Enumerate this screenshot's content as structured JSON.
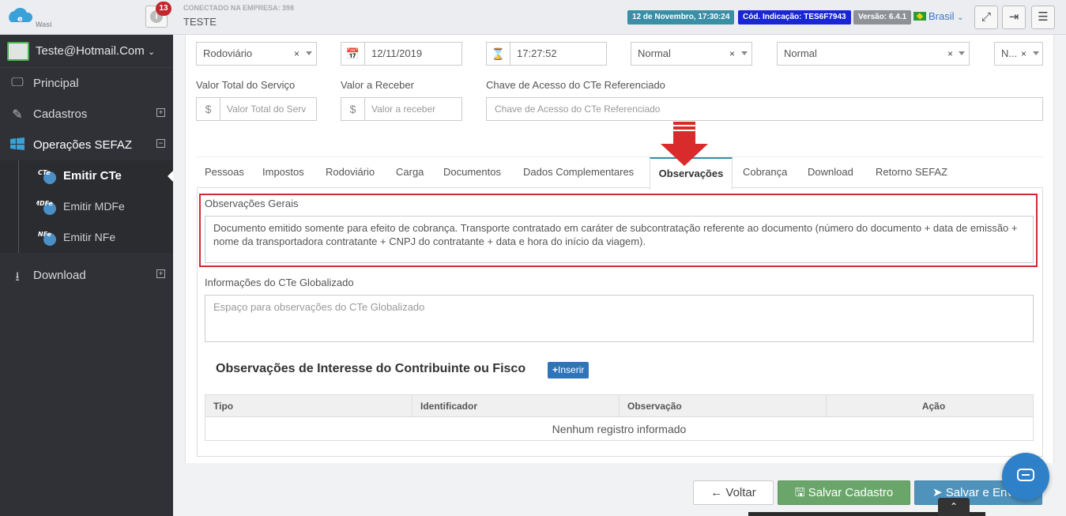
{
  "header": {
    "logo_text": "Wasi",
    "notification_count": "13",
    "company_label": "CONECTADO NA EMPRESA: 398",
    "company_name": "TESTE",
    "date_tag": "12 de Novembro, 17:30:24",
    "code_tag": "Cód. Indicação: TES6F7943",
    "version_tag": "Versão: 6.4.1",
    "language": "Brasil",
    "icons": [
      "expand-icon",
      "logout-icon",
      "menu-icon"
    ],
    "colors": {
      "date": "#3a8ea5",
      "code": "#1826d6",
      "version": "#8e9296",
      "badge": "#c1272d"
    }
  },
  "sidebar": {
    "user": "Teste@Hotmail.Com",
    "items": [
      {
        "label": "Principal",
        "icon": "monitor-icon"
      },
      {
        "label": "Cadastros",
        "icon": "edit-icon"
      },
      {
        "label": "Operações SEFAZ",
        "icon": "windows-icon"
      },
      {
        "label": "Download",
        "icon": "download-icon"
      }
    ],
    "subitems": [
      {
        "label": "Emitir CTe",
        "icon_text": "CTe"
      },
      {
        "label": "Emitir MDFe",
        "icon_text": "MDFe"
      },
      {
        "label": "Emitir NFe",
        "icon_text": "NFe"
      }
    ]
  },
  "form": {
    "modal": "Rodoviário",
    "date": "12/11/2019",
    "time": "17:27:52",
    "select1": "Normal",
    "select2": "Normal",
    "select3": "N...",
    "valor_total_label": "Valor Total do Serviço",
    "valor_total_placeholder": "Valor Total do Serv",
    "valor_receber_label": "Valor a Receber",
    "valor_receber_placeholder": "Valor a receber",
    "chave_label": "Chave de Acesso do CTe Referenciado",
    "chave_placeholder": "Chave de Acesso do CTe Referenciado",
    "currency_symbol": "$"
  },
  "tabs": [
    "Pessoas",
    "Impostos",
    "Rodoviário",
    "Carga",
    "Documentos",
    "Dados Complementares",
    "Observações",
    "Cobrança",
    "Download",
    "Retorno SEFAZ"
  ],
  "obs": {
    "gerais_label": "Observações Gerais",
    "gerais_text": "Documento emitido somente para efeito de cobrança. Transporte contratado em caráter de subcontratação referente ao documento (número do documento + data de emissão + nome da transportadora contratante + CNPJ do contratante + data e hora do início da viagem).",
    "glob_label": "Informações do CTe Globalizado",
    "glob_placeholder": "Espaço para observações do CTe Globalizado",
    "section_title": "Observações de Interesse do Contribuinte ou Fisco",
    "insert_button": "Inserir",
    "columns": [
      "Tipo",
      "Identificador",
      "Observação",
      "Ação"
    ],
    "empty": "Nenhum registro informado"
  },
  "footer": {
    "back": "Voltar",
    "save": "Salvar Cadastro",
    "send": "Salvar e Enviar"
  }
}
